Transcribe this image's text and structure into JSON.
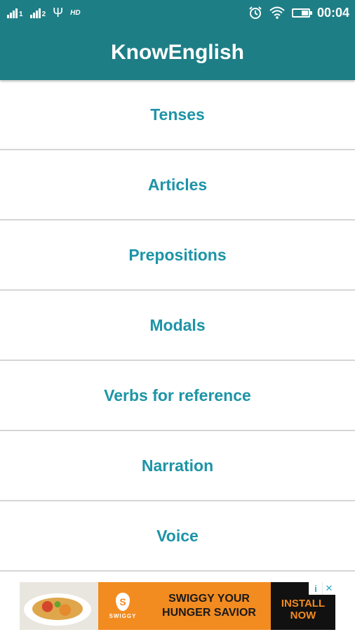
{
  "status_bar": {
    "sim1_label": "1",
    "sim2_label": "2",
    "usb_symbol": "Ψ",
    "hd_label": "HD",
    "time": "00:04",
    "icons": [
      "signal-icon",
      "usb-icon",
      "alarm-icon",
      "wifi-icon",
      "battery-icon"
    ]
  },
  "app_bar": {
    "title": "KnowEnglish"
  },
  "menu": {
    "items": [
      {
        "label": "Tenses"
      },
      {
        "label": "Articles"
      },
      {
        "label": "Prepositions"
      },
      {
        "label": "Modals"
      },
      {
        "label": "Verbs for reference"
      },
      {
        "label": "Narration"
      },
      {
        "label": "Voice"
      }
    ]
  },
  "ad": {
    "brand": "SWIGGY",
    "tagline_line1": "SWIGGY YOUR",
    "tagline_line2": "HUNGER SAVIOR",
    "cta_line1": "INSTALL",
    "cta_line2": "NOW",
    "info_symbol": "i",
    "close_symbol": "✕"
  },
  "colors": {
    "primary": "#1e7e86",
    "menu_text": "#1d94a7",
    "ad_orange": "#f28b20",
    "divider": "#d6d6d6"
  }
}
